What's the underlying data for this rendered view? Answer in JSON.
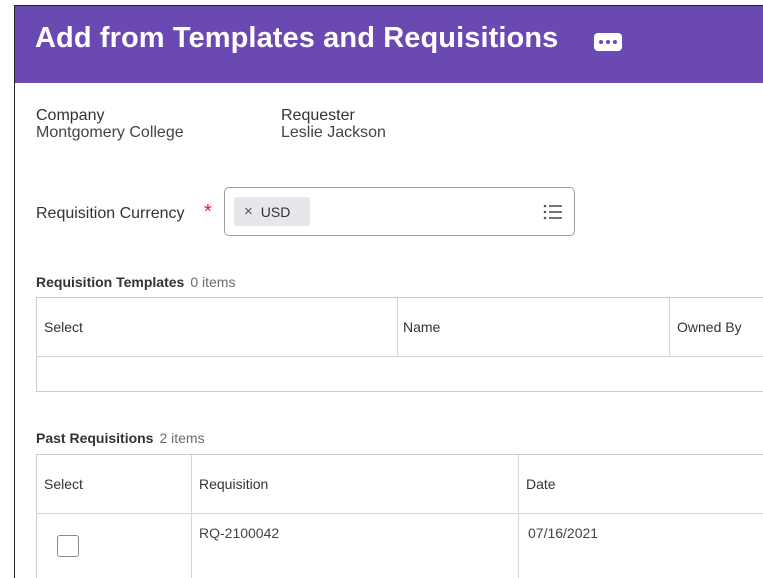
{
  "header": {
    "title": "Add from Templates and Requisitions",
    "more_icon": "more-horizontal-icon"
  },
  "info": {
    "company_label": "Company",
    "company_value": "Montgomery College",
    "requester_label": "Requester",
    "requester_value": "Leslie Jackson"
  },
  "currency": {
    "label": "Requisition Currency",
    "required_mark": "*",
    "selected": "USD",
    "remove_symbol": "×",
    "list_icon": "list-icon"
  },
  "templates": {
    "title": "Requisition Templates",
    "count": "0 items",
    "columns": [
      "Select",
      "Name",
      "Owned By"
    ]
  },
  "past": {
    "title": "Past Requisitions",
    "count": "2 items",
    "columns": [
      "Select",
      "Requisition",
      "Date"
    ],
    "rows": [
      {
        "requisition": "RQ-2100042",
        "date": "07/16/2021",
        "checked": false
      }
    ]
  },
  "colors": {
    "header_bg": "#6b49b3",
    "required": "#d9262a"
  }
}
